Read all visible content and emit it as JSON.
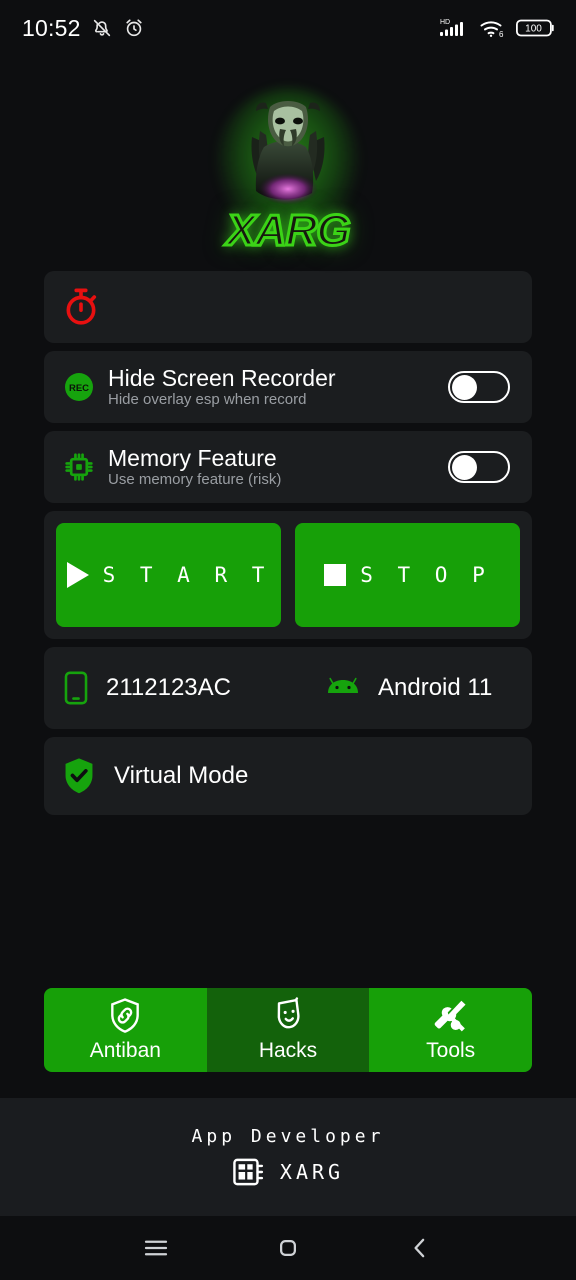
{
  "statusbar": {
    "time": "10:52",
    "icons_left": [
      "mute-bell-icon",
      "alarm-clock-icon"
    ],
    "icons_right": [
      "hd-signal-icon",
      "wifi6-icon",
      "battery-icon"
    ],
    "battery_level": "100",
    "network_label": "HD",
    "wifi_label": "6"
  },
  "logo": {
    "brand": "XARG",
    "alt": "xarg-predator-logo",
    "glow_color": "#3bd317"
  },
  "timer_card": {
    "icon": "stopwatch-icon",
    "icon_color": "#e81010",
    "value": ""
  },
  "toggles": [
    {
      "icon": "rec-icon",
      "title": "Hide Screen Recorder",
      "subtitle": "Hide overlay esp when record",
      "state": "off"
    },
    {
      "icon": "memory-chip-icon",
      "title": "Memory Feature",
      "subtitle": "Use memory feature (risk)",
      "state": "off"
    }
  ],
  "actions": {
    "start_label": "S T A R T",
    "stop_label": "S T O P",
    "button_color": "#17a008"
  },
  "device": {
    "model_icon": "phone-icon",
    "model": "2112123AC",
    "os_icon": "android-icon",
    "os": "Android 11"
  },
  "virtual_mode": {
    "icon": "shield-check-icon",
    "label": "Virtual Mode"
  },
  "tabs": [
    {
      "label": "Antiban",
      "icon": "shield-link-icon",
      "selected": true
    },
    {
      "label": "Hacks",
      "icon": "theater-mask-icon",
      "selected": false
    },
    {
      "label": "Tools",
      "icon": "wrench-screwdriver-icon",
      "selected": true
    }
  ],
  "footer": {
    "title": "App Developer",
    "icon": "chip-icon",
    "developer": "XARG"
  },
  "navbar": {
    "recents": "recents-icon",
    "home": "home-icon",
    "back": "back-icon"
  }
}
